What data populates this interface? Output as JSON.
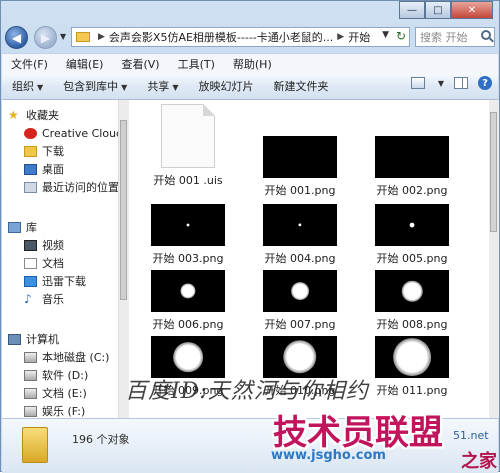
{
  "window": {
    "caption": {
      "minimize": "—",
      "maximize": "□",
      "close": "✕"
    }
  },
  "address": {
    "crumbs": [
      "会声会影X5仿AE相册模板-----卡通小老鼠的...",
      "开始"
    ],
    "search_placeholder": "搜索 开始"
  },
  "menu": [
    "文件(F)",
    "编辑(E)",
    "查看(V)",
    "工具(T)",
    "帮助(H)"
  ],
  "toolbar": {
    "organize": "组织",
    "include": "包含到库中",
    "share": "共享",
    "slideshow": "放映幻灯片",
    "new_folder": "新建文件夹"
  },
  "nav": {
    "favorites": {
      "title": "收藏夹",
      "items": [
        "Creative Cloud",
        "下载",
        "桌面",
        "最近访问的位置"
      ]
    },
    "libraries": {
      "title": "库",
      "items": [
        "视频",
        "文档",
        "迅雷下载",
        "音乐"
      ]
    },
    "computer": {
      "title": "计算机",
      "items": [
        "本地磁盘 (C:)",
        "软件 (D:)",
        "文档 (E:)",
        "娱乐 (F:)"
      ]
    }
  },
  "files": [
    {
      "name": "开始 001 .uis",
      "type": "doc"
    },
    {
      "name": "开始 001.png",
      "type": "png",
      "glow": 0
    },
    {
      "name": "开始 002.png",
      "type": "png",
      "glow": 0
    },
    {
      "name": "开始 003.png",
      "type": "png",
      "glow": 0.03
    },
    {
      "name": "开始 004.png",
      "type": "png",
      "glow": 0.06
    },
    {
      "name": "开始 005.png",
      "type": "png",
      "glow": 0.09
    },
    {
      "name": "开始 006.png",
      "type": "png",
      "glow": 0.28
    },
    {
      "name": "开始 007.png",
      "type": "png",
      "glow": 0.33
    },
    {
      "name": "开始 008.png",
      "type": "png",
      "glow": 0.38
    },
    {
      "name": "开始 009.png",
      "type": "png",
      "glow": 0.55
    },
    {
      "name": "开始 010.png",
      "type": "png",
      "glow": 0.62
    },
    {
      "name": "开始 011.png",
      "type": "png",
      "glow": 0.7
    }
  ],
  "details": {
    "count": "196 个对象"
  },
  "watermarks": {
    "baidu": "百度ID:天然河与你相约",
    "site_cn": "技术员联盟",
    "site_url": "www.jsgho.com",
    "site_tail": "51.net",
    "site_house": "之家"
  }
}
